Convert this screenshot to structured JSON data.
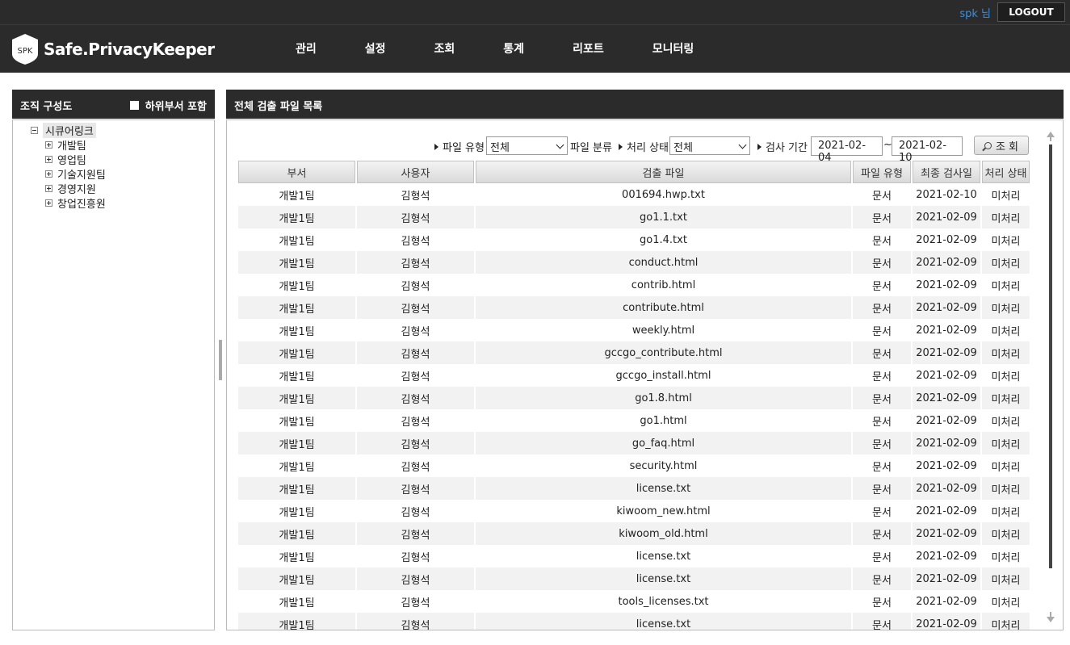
{
  "topbar": {
    "user": "spk 님",
    "logout": "LOGOUT"
  },
  "header": {
    "logo_badge": "SPK",
    "logo_text": "Safe.PrivacyKeeper",
    "nav": [
      "관리",
      "설정",
      "조회",
      "통계",
      "리포트",
      "모니터링"
    ]
  },
  "left": {
    "title": "조직 구성도",
    "include_sub": "하위부서 포함",
    "tree": {
      "root": "시큐어링크",
      "children": [
        "개발팀",
        "영업팀",
        "기술지원팀",
        "경영지원",
        "창업진흥원"
      ]
    }
  },
  "right": {
    "title": "전체 검출 파일 목록",
    "filters": {
      "file_type_label": "파일 유형",
      "file_type_value": "전체",
      "file_class_label": "파일 분류",
      "status_label": "처리 상태",
      "status_value": "전체",
      "period_label": "검사 기간",
      "date_from": "2021-02-04",
      "date_sep": "~",
      "date_to": "2021-02-10",
      "search_button": "조 회"
    },
    "columns": [
      "부서",
      "사용자",
      "검출 파일",
      "파일 유형",
      "최종 검사일",
      "처리 상태"
    ],
    "rows": [
      [
        "개발1팀",
        "김형석",
        "001694.hwp.txt",
        "문서",
        "2021-02-10",
        "미처리"
      ],
      [
        "개발1팀",
        "김형석",
        "go1.1.txt",
        "문서",
        "2021-02-09",
        "미처리"
      ],
      [
        "개발1팀",
        "김형석",
        "go1.4.txt",
        "문서",
        "2021-02-09",
        "미처리"
      ],
      [
        "개발1팀",
        "김형석",
        "conduct.html",
        "문서",
        "2021-02-09",
        "미처리"
      ],
      [
        "개발1팀",
        "김형석",
        "contrib.html",
        "문서",
        "2021-02-09",
        "미처리"
      ],
      [
        "개발1팀",
        "김형석",
        "contribute.html",
        "문서",
        "2021-02-09",
        "미처리"
      ],
      [
        "개발1팀",
        "김형석",
        "weekly.html",
        "문서",
        "2021-02-09",
        "미처리"
      ],
      [
        "개발1팀",
        "김형석",
        "gccgo_contribute.html",
        "문서",
        "2021-02-09",
        "미처리"
      ],
      [
        "개발1팀",
        "김형석",
        "gccgo_install.html",
        "문서",
        "2021-02-09",
        "미처리"
      ],
      [
        "개발1팀",
        "김형석",
        "go1.8.html",
        "문서",
        "2021-02-09",
        "미처리"
      ],
      [
        "개발1팀",
        "김형석",
        "go1.html",
        "문서",
        "2021-02-09",
        "미처리"
      ],
      [
        "개발1팀",
        "김형석",
        "go_faq.html",
        "문서",
        "2021-02-09",
        "미처리"
      ],
      [
        "개발1팀",
        "김형석",
        "security.html",
        "문서",
        "2021-02-09",
        "미처리"
      ],
      [
        "개발1팀",
        "김형석",
        "license.txt",
        "문서",
        "2021-02-09",
        "미처리"
      ],
      [
        "개발1팀",
        "김형석",
        "kiwoom_new.html",
        "문서",
        "2021-02-09",
        "미처리"
      ],
      [
        "개발1팀",
        "김형석",
        "kiwoom_old.html",
        "문서",
        "2021-02-09",
        "미처리"
      ],
      [
        "개발1팀",
        "김형석",
        "license.txt",
        "문서",
        "2021-02-09",
        "미처리"
      ],
      [
        "개발1팀",
        "김형석",
        "license.txt",
        "문서",
        "2021-02-09",
        "미처리"
      ],
      [
        "개발1팀",
        "김형석",
        "tools_licenses.txt",
        "문서",
        "2021-02-09",
        "미처리"
      ],
      [
        "개발1팀",
        "김형석",
        "license.txt",
        "문서",
        "2021-02-09",
        "미처리"
      ]
    ]
  }
}
